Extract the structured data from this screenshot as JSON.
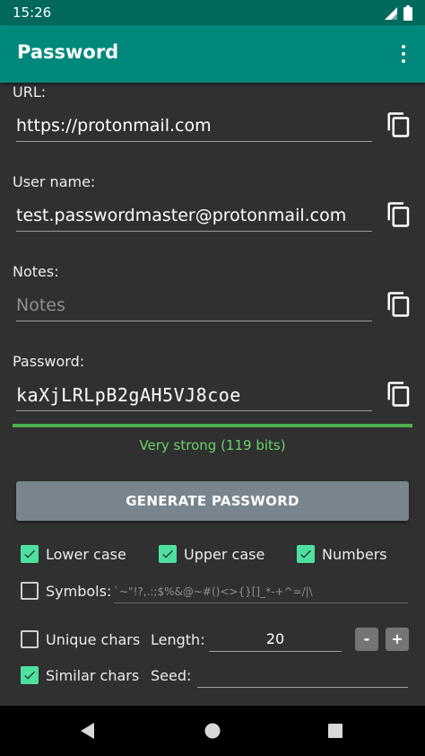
{
  "status_bar": {
    "time": "15:26"
  },
  "app_bar": {
    "title": "Password"
  },
  "fields": {
    "url": {
      "label": "URL:",
      "value": "https://protonmail.com",
      "placeholder": ""
    },
    "username": {
      "label": "User name:",
      "value": "test.passwordmaster@protonmail.com",
      "placeholder": ""
    },
    "notes": {
      "label": "Notes:",
      "value": "",
      "placeholder": "Notes"
    },
    "password": {
      "label": "Password:",
      "value": "kaXjLRLpB2gAH5VJ8coe",
      "placeholder": ""
    }
  },
  "strength": {
    "text": "Very strong (119 bits)",
    "color": "#4caf50",
    "fill": 1.0
  },
  "generate_button": {
    "label": "GENERATE PASSWORD"
  },
  "options": {
    "lower_case": {
      "label": "Lower case",
      "checked": true
    },
    "upper_case": {
      "label": "Upper case",
      "checked": true
    },
    "numbers": {
      "label": "Numbers",
      "checked": true
    },
    "symbols": {
      "label": "Symbols:",
      "checked": false,
      "value": "`~\"!?,.:;$%&@~#()<>{}[]_*-+^=/|\\"
    },
    "unique_chars": {
      "label": "Unique chars",
      "checked": false
    },
    "similar_chars": {
      "label": "Similar chars",
      "checked": true
    }
  },
  "length": {
    "label": "Length:",
    "value": "20",
    "minus_label": "-",
    "plus_label": "+"
  },
  "seed": {
    "label": "Seed:",
    "value": ""
  },
  "colors": {
    "primary": "#00897b",
    "primary_dark": "#00695c",
    "accent": "#4ee0a0",
    "background": "#303030"
  }
}
